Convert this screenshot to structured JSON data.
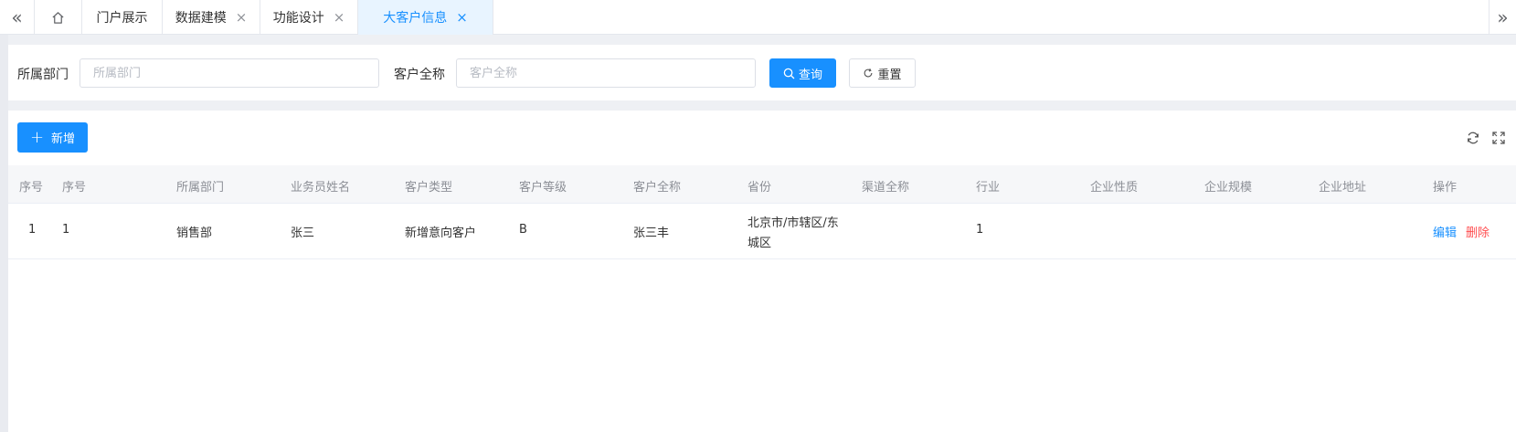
{
  "tabs": {
    "items": [
      {
        "label": "门户展示",
        "closable": false
      },
      {
        "label": "数据建模",
        "closable": true
      },
      {
        "label": "功能设计",
        "closable": true
      },
      {
        "label": "大客户信息",
        "closable": true,
        "active": true
      }
    ],
    "close_glyph": "×",
    "left_arrow": "«",
    "right_arrow": "»"
  },
  "search": {
    "dept_label": "所属部门",
    "dept_placeholder": "所属部门",
    "dept_value": "",
    "customer_label": "客户全称",
    "customer_placeholder": "客户全称",
    "customer_value": "",
    "query_label": "查询",
    "reset_label": "重置"
  },
  "toolbar": {
    "add_label": "新增",
    "add_glyph": "+"
  },
  "table": {
    "columns": [
      "序号",
      "序号",
      "所属部门",
      "业务员姓名",
      "客户类型",
      "客户等级",
      "客户全称",
      "省份",
      "渠道全称",
      "行业",
      "企业性质",
      "企业规模",
      "企业地址",
      "操作"
    ],
    "rows": [
      {
        "index": "1",
        "seq": "1",
        "dept": "销售部",
        "salesman": "张三",
        "customer_type": "新增意向客户",
        "customer_level": "B",
        "customer_name": "张三丰",
        "province": "北京市/市辖区/东城区",
        "channel": "",
        "industry": "1",
        "nature": "",
        "scale": "",
        "address": "",
        "edit_label": "编辑",
        "delete_label": "删除"
      }
    ]
  },
  "colors": {
    "primary": "#1890ff",
    "danger": "#ff4d4f",
    "active_tab_bg": "#e8f4ff"
  },
  "icons": {
    "home": "home-icon",
    "search": "search-icon",
    "reset": "refresh-icon",
    "reload": "reload-icon",
    "fullscreen": "fullscreen-icon"
  }
}
